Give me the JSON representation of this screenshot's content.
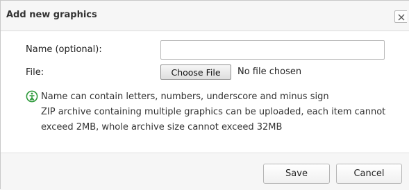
{
  "dialog": {
    "title": "Add new graphics",
    "close_label": "X"
  },
  "form": {
    "name_label": "Name (optional):",
    "name_value": "",
    "name_placeholder": "",
    "file_label": "File:",
    "file_button_label": "Choose File",
    "file_status": "No file chosen"
  },
  "hint": {
    "icon": "info-icon",
    "icon_color": "#2e9a3b",
    "lines": [
      "Name can contain letters, numbers, underscore and minus sign",
      "ZIP archive containing multiple graphics can be uploaded, each item cannot",
      "exceed 2MB, whole archive size cannot exceed 32MB"
    ]
  },
  "footer": {
    "save_label": "Save",
    "cancel_label": "Cancel"
  }
}
